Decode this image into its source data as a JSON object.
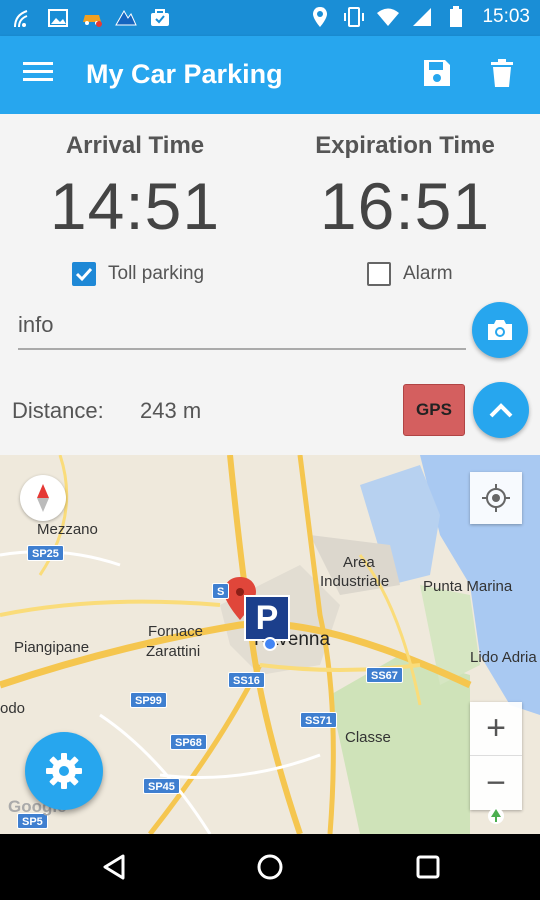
{
  "status_bar": {
    "time": "15:03",
    "icons_left": [
      "wifi-signal-icon",
      "image-icon",
      "car-icon",
      "cloud-icon",
      "briefcase-icon"
    ],
    "icons_right": [
      "location-icon",
      "vibrate-icon",
      "wifi-icon",
      "signal-icon",
      "battery-icon"
    ]
  },
  "app_bar": {
    "title": "My Car Parking",
    "menu_icon": "menu-icon",
    "save_icon": "save-icon",
    "delete_icon": "delete-icon",
    "color": "#27a6ee"
  },
  "times": {
    "arrival_label": "Arrival Time",
    "arrival_value": "14:51",
    "expiration_label": "Expiration Time",
    "expiration_value": "16:51"
  },
  "options": {
    "toll_label": "Toll parking",
    "toll_checked": true,
    "alarm_label": "Alarm",
    "alarm_checked": false
  },
  "info": {
    "value": "info"
  },
  "distance": {
    "label": "Distance:",
    "value": "243 m"
  },
  "gps_button": {
    "label": "GPS",
    "color": "#d45f5f"
  },
  "map": {
    "labels": {
      "mezzano": "Mezzano",
      "area_industriale_1": "Area",
      "area_industriale_2": "Industriale",
      "punta_marina": "Punta Marina",
      "fornace_1": "Fornace",
      "fornace_2": "Zarattini",
      "piangipane": "Piangipane",
      "ravenna": "Ravenna",
      "lido_adriano": "Lido Adria",
      "classe": "Classe",
      "odo": "odo"
    },
    "roads": {
      "sp25": "SP25",
      "ss16": "SS16",
      "sp99": "SP99",
      "sp68": "SP68",
      "sp45": "SP45",
      "sp5": "SP5",
      "ss67": "SS67",
      "ss71": "SS71",
      "s_trunc": "S"
    },
    "parking_letter": "P",
    "zoom_in": "+",
    "zoom_out": "−",
    "attribution": "Google"
  },
  "nav_bar": {
    "back_icon": "back-icon",
    "home_icon": "home-icon",
    "recents_icon": "recents-icon"
  }
}
